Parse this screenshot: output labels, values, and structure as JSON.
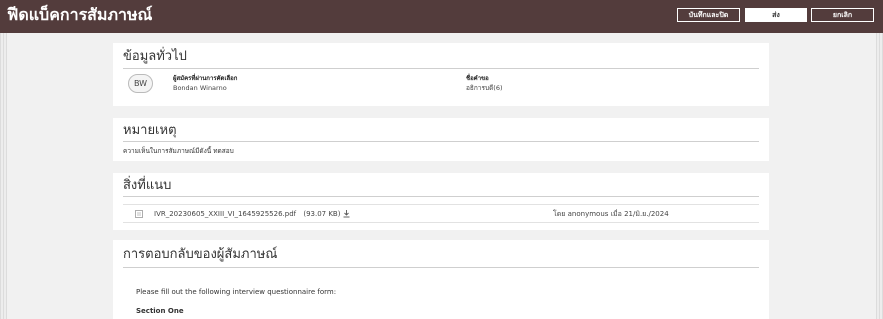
{
  "header": {
    "title": "ฟีดแบ็คการสัมภาษณ์",
    "save_close_label": "บันทึกและปิด",
    "submit_label": "ส่ง",
    "cancel_label": "ยกเลิก"
  },
  "general_info": {
    "title": "ข้อมูลทั่วไป",
    "avatar_initials": "BW",
    "candidate_label": "ผู้สมัครที่ผ่านการคัดเลือก",
    "candidate_name": "Bondan Winarno",
    "request_label": "ชื่อคำขอ",
    "request_value": "อธิการบดี(6)"
  },
  "notes": {
    "title": "หมายเหตุ",
    "text": "ความเห็นในการสัมภาษณ์มีดังนี้ ทดสอบ"
  },
  "attachments": {
    "title": "สิ่งที่แนบ",
    "items": [
      {
        "file_name": "IVR_20230605_XXIII_VI_1645925526.pdf",
        "file_size": "(93.07 KB)",
        "meta": "โดย anonymous เมื่อ 21/มิ.ย./2024"
      }
    ]
  },
  "interviewer_response": {
    "title": "การตอบกลับของผู้สัมภาษณ์",
    "intro": "Please fill out the following interview questionnaire form:",
    "section": "Section One"
  },
  "colors": {
    "header_bg": "#533c3c",
    "page_bg": "#f1f1f1",
    "card_bg": "#ffffff"
  },
  "icons": {
    "file": "document-icon",
    "download": "download-icon"
  }
}
